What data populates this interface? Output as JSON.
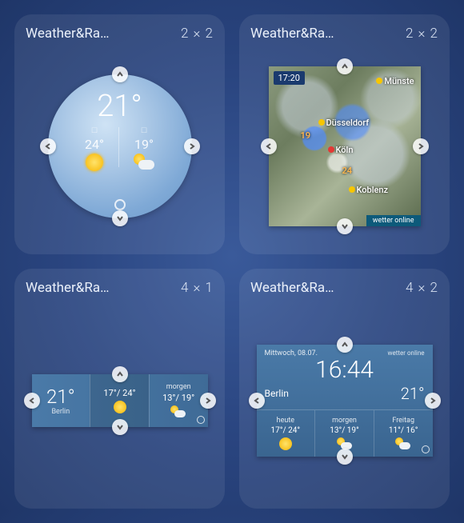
{
  "widgets": [
    {
      "title": "Weather&Ra…",
      "size": "2 × 2",
      "circle": {
        "current_temp": "21°",
        "left_day_icon": "☐",
        "left_temp": "24°",
        "right_day_icon": "☐",
        "right_temp": "19°"
      }
    },
    {
      "title": "Weather&Ra…",
      "size": "2 × 2",
      "map": {
        "time": "17:20",
        "cities": {
          "munster": "Münste",
          "dusseldorf": "Düsseldorf",
          "koln": "Köln",
          "koblenz": "Koblenz"
        },
        "temps": {
          "t1": "19",
          "t2": "24"
        },
        "brand": "wetter online"
      }
    },
    {
      "title": "Weather&Ra…",
      "size": "4 × 1",
      "bar": {
        "current_temp": "21°",
        "city": "Berlin",
        "mid_temps": "17°/ 24°",
        "right_label": "morgen",
        "right_temps": "13°/ 19°"
      }
    },
    {
      "title": "Weather&Ra…",
      "size": "4 × 2",
      "panel": {
        "date": "Mittwoch, 08.07.",
        "brand": "wetter online",
        "time": "16:44",
        "city": "Berlin",
        "current_temp": "21°",
        "cols": [
          {
            "label": "heute",
            "temps": "17°/ 24°"
          },
          {
            "label": "morgen",
            "temps": "13°/ 19°"
          },
          {
            "label": "Freitag",
            "temps": "11°/ 16°"
          }
        ]
      }
    }
  ]
}
